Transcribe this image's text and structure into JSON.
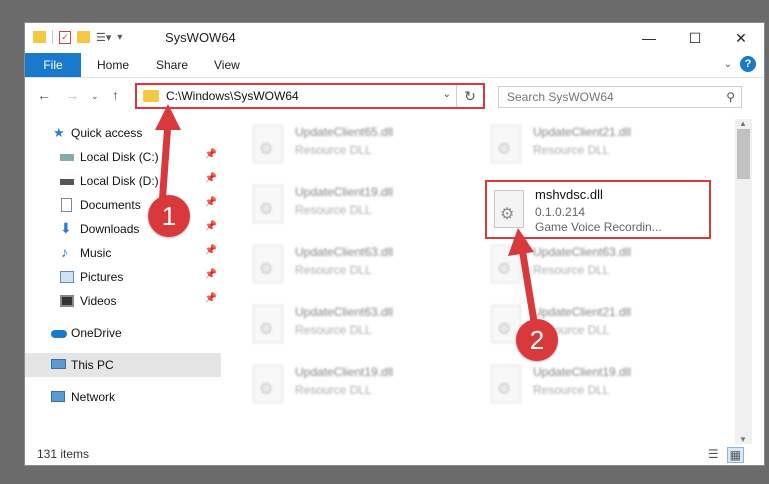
{
  "window": {
    "title": "SysWOW64"
  },
  "ribbon": {
    "file": "File",
    "home": "Home",
    "share": "Share",
    "view": "View"
  },
  "nav": {
    "address": "C:\\Windows\\SysWOW64",
    "search_placeholder": "Search SysWOW64"
  },
  "sidebar": {
    "items": [
      {
        "label": "Quick access",
        "icon": "star-icon"
      },
      {
        "label": "Local Disk (C:)",
        "icon": "drive-icon"
      },
      {
        "label": "Local Disk (D:)",
        "icon": "drive-icon"
      },
      {
        "label": "Documents",
        "icon": "documents-icon"
      },
      {
        "label": "Downloads",
        "icon": "downloads-icon"
      },
      {
        "label": "Music",
        "icon": "music-icon"
      },
      {
        "label": "Pictures",
        "icon": "pictures-icon"
      },
      {
        "label": "Videos",
        "icon": "videos-icon"
      },
      {
        "label": "OneDrive",
        "icon": "cloud-icon"
      },
      {
        "label": "This PC",
        "icon": "computer-icon"
      },
      {
        "label": "Network",
        "icon": "network-icon"
      }
    ]
  },
  "files": [
    {
      "name": "UpdateClient65.dll",
      "type": "Resource DLL"
    },
    {
      "name": "UpdateClient21.dll",
      "type": "Resource DLL"
    },
    {
      "name": "UpdateClient19.dll",
      "type": "Resource DLL"
    },
    {
      "name": "UpdateClient63.dll",
      "type": "Resource DLL"
    },
    {
      "name": "UpdateClient63.dll",
      "type": "Resource DLL"
    },
    {
      "name": "UpdateClient63.dll",
      "type": "Resource DLL"
    },
    {
      "name": "UpdateClient21.dll",
      "type": "Resource DLL"
    },
    {
      "name": "UpdateClient19.dll",
      "type": "Resource DLL"
    },
    {
      "name": "UpdateClient19.dll",
      "type": "Resource DLL"
    }
  ],
  "highlighted": {
    "name": "mshvdsc.dll",
    "version": "0.1.0.214",
    "description": "Game Voice Recordin..."
  },
  "annotations": {
    "one": "1",
    "two": "2",
    "color": "#d9393b"
  },
  "status": {
    "count": "131 items"
  }
}
